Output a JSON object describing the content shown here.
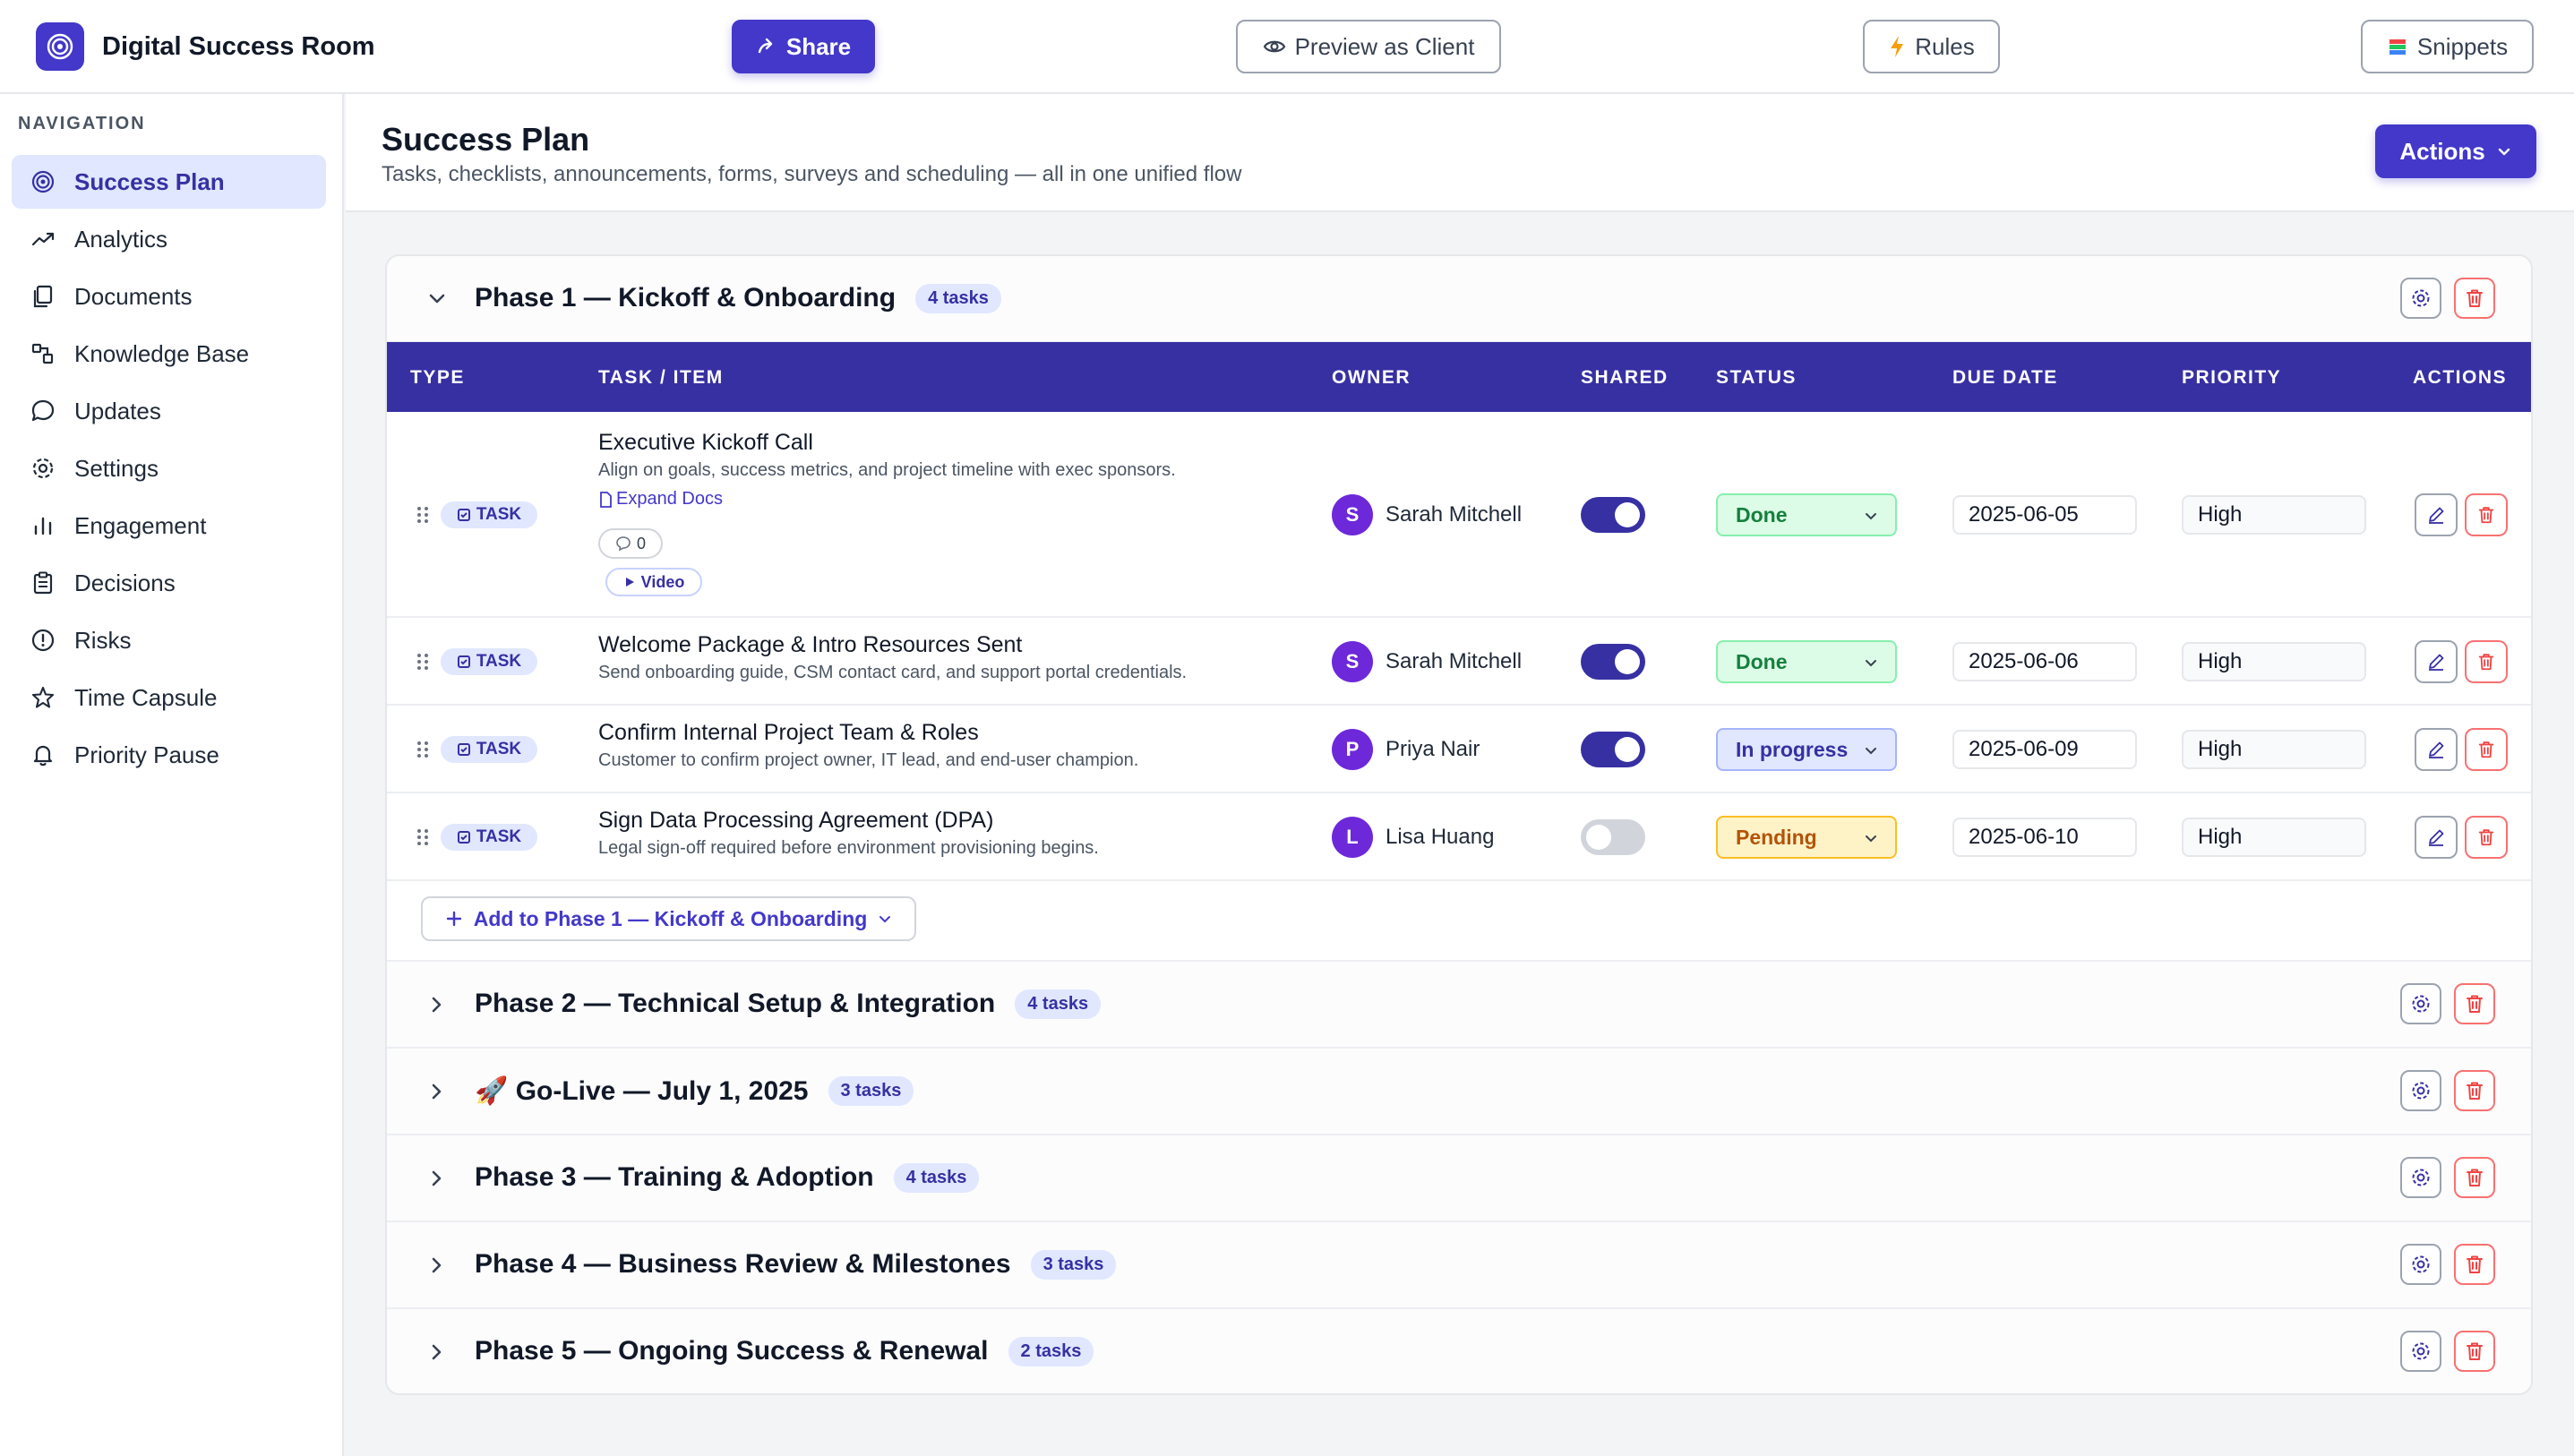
{
  "app": {
    "title": "Digital Success Room",
    "share_label": "Share",
    "preview_label": "Preview as Client",
    "rules_label": "Rules",
    "snippets_label": "Snippets"
  },
  "sidebar": {
    "heading": "NAVIGATION",
    "items": [
      {
        "label": "Success Plan",
        "icon": "target-icon",
        "active": true
      },
      {
        "label": "Analytics",
        "icon": "trend-icon"
      },
      {
        "label": "Documents",
        "icon": "documents-icon"
      },
      {
        "label": "Knowledge Base",
        "icon": "knowledge-icon"
      },
      {
        "label": "Updates",
        "icon": "chat-icon"
      },
      {
        "label": "Settings",
        "icon": "gear-icon"
      },
      {
        "label": "Engagement",
        "icon": "bar-chart-icon"
      },
      {
        "label": "Decisions",
        "icon": "clipboard-icon"
      },
      {
        "label": "Risks",
        "icon": "alert-icon"
      },
      {
        "label": "Time Capsule",
        "icon": "star-icon"
      },
      {
        "label": "Priority Pause",
        "icon": "bell-icon"
      }
    ]
  },
  "header": {
    "title": "Success Plan",
    "subtitle": "Tasks, checklists, announcements, forms, surveys and scheduling — all in one unified flow",
    "actions_label": "Actions"
  },
  "table": {
    "columns": [
      "TYPE",
      "TASK / ITEM",
      "OWNER",
      "SHARED",
      "STATUS",
      "DUE DATE",
      "PRIORITY",
      "ACTIONS"
    ]
  },
  "phases": [
    {
      "title": "Phase 1 — Kickoff & Onboarding",
      "count": "4 tasks",
      "expanded": true,
      "add_label": "Add to Phase 1 — Kickoff & Onboarding",
      "tasks": [
        {
          "type": "TASK",
          "title": "Executive Kickoff Call",
          "desc": "Align on goals, success metrics, and project timeline with exec sponsors.",
          "link": "Expand Docs",
          "comments": "0",
          "video": "Video",
          "owner": "Sarah Mitchell",
          "initial": "S",
          "shared": true,
          "status": "Done",
          "due": "2025-06-05",
          "priority": "High"
        },
        {
          "type": "TASK",
          "title": "Welcome Package & Intro Resources Sent",
          "desc": "Send onboarding guide, CSM contact card, and support portal credentials.",
          "owner": "Sarah Mitchell",
          "initial": "S",
          "shared": true,
          "status": "Done",
          "due": "2025-06-06",
          "priority": "High"
        },
        {
          "type": "TASK",
          "title": "Confirm Internal Project Team & Roles",
          "desc": "Customer to confirm project owner, IT lead, and end-user champion.",
          "owner": "Priya Nair",
          "initial": "P",
          "shared": true,
          "status": "In progress",
          "due": "2025-06-09",
          "priority": "High"
        },
        {
          "type": "TASK",
          "title": "Sign Data Processing Agreement (DPA)",
          "desc": "Legal sign-off required before environment provisioning begins.",
          "owner": "Lisa Huang",
          "initial": "L",
          "shared": false,
          "status": "Pending",
          "due": "2025-06-10",
          "priority": "High"
        }
      ]
    },
    {
      "title": "Phase 2 — Technical Setup & Integration",
      "count": "4 tasks"
    },
    {
      "title": "🚀 Go-Live — July 1, 2025",
      "count": "3 tasks"
    },
    {
      "title": "Phase 3 — Training & Adoption",
      "count": "4 tasks"
    },
    {
      "title": "Phase 4 — Business Review & Milestones",
      "count": "3 tasks"
    },
    {
      "title": "Phase 5 — Ongoing Success & Renewal",
      "count": "2 tasks"
    }
  ],
  "colors": {
    "accent": "#4338ca",
    "header": "#3730a3",
    "done": "#15803d",
    "progress": "#3730a3",
    "pending": "#b45309",
    "danger": "#ef4444"
  }
}
